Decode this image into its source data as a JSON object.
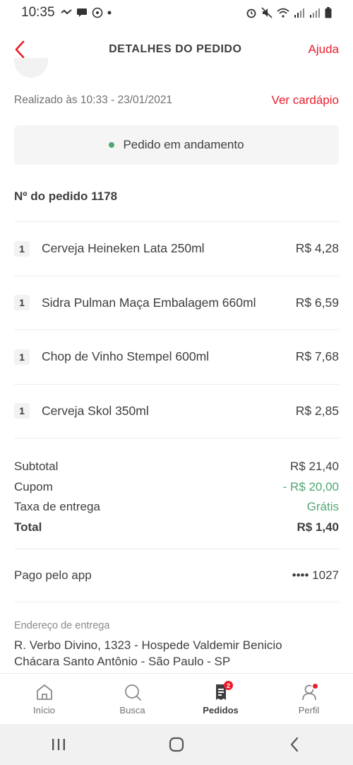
{
  "status_bar": {
    "time": "10:35"
  },
  "header": {
    "title": "DETALHES DO PEDIDO",
    "help": "Ajuda"
  },
  "order": {
    "placed_at": "Realizado às 10:33 - 23/01/2021",
    "menu_link": "Ver cardápio",
    "status": "Pedido em andamento",
    "number": "Nº do pedido 1178"
  },
  "items": [
    {
      "qty": "1",
      "name": "Cerveja Heineken Lata 250ml",
      "price": "R$ 4,28"
    },
    {
      "qty": "1",
      "name": "Sidra Pulman Maça Embalagem 660ml",
      "price": "R$ 6,59"
    },
    {
      "qty": "1",
      "name": "Chop de Vinho Stempel 600ml",
      "price": "R$ 7,68"
    },
    {
      "qty": "1",
      "name": "Cerveja Skol 350ml",
      "price": "R$ 2,85"
    }
  ],
  "totals": {
    "subtotal_label": "Subtotal",
    "subtotal_value": "R$ 21,40",
    "coupon_label": "Cupom",
    "coupon_value": "- R$ 20,00",
    "delivery_label": "Taxa de entrega",
    "delivery_value": "Grátis",
    "total_label": "Total",
    "total_value": "R$ 1,40"
  },
  "payment": {
    "label": "Pago pelo app",
    "card": "•••• 1027"
  },
  "address": {
    "label": "Endereço de entrega",
    "line1": "R. Verbo Divino, 1323 - Hospede Valdemir Benicio",
    "line2": "Chácara Santo Antônio - São Paulo - SP"
  },
  "bottom_nav": [
    {
      "label": "Início",
      "icon": "home-icon"
    },
    {
      "label": "Busca",
      "icon": "search-icon"
    },
    {
      "label": "Pedidos",
      "icon": "orders-icon",
      "badge": "2",
      "active": true
    },
    {
      "label": "Perfil",
      "icon": "profile-icon"
    }
  ],
  "colors": {
    "accent": "#ea1d2c",
    "green": "#50a773",
    "text": "#3e3e3e",
    "muted": "#717171"
  }
}
